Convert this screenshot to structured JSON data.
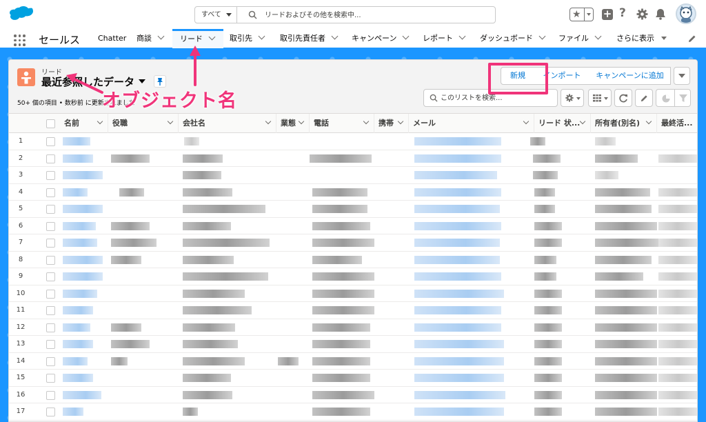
{
  "header": {
    "search_scope": "すべて",
    "search_placeholder": "リードおよびその他を検索中...",
    "icons": [
      "favorites-star-icon",
      "plus-icon",
      "help-icon",
      "gear-icon",
      "bell-icon",
      "avatar"
    ]
  },
  "nav": {
    "app_name": "セールス",
    "items": [
      {
        "label": "Chatter",
        "has_menu": false
      },
      {
        "label": "商談",
        "has_menu": true
      },
      {
        "label": "リード",
        "has_menu": true,
        "active": true
      },
      {
        "label": "取引先",
        "has_menu": true
      },
      {
        "label": "取引先責任者",
        "has_menu": true
      },
      {
        "label": "キャンペーン",
        "has_menu": true
      },
      {
        "label": "レポート",
        "has_menu": true
      },
      {
        "label": "ダッシュボード",
        "has_menu": true
      },
      {
        "label": "ファイル",
        "has_menu": true
      }
    ],
    "more_label": "さらに表示"
  },
  "list": {
    "object_label": "リード",
    "title": "最近参照したデータ",
    "info": "50+ 個の項目 • 数秒前 に更新されました",
    "buttons": {
      "new": "新規",
      "import": "インポート",
      "add_to_campaign": "キャンペーンに追加"
    },
    "search_placeholder": "このリストを検索...",
    "columns": [
      "名前",
      "役職",
      "会社名",
      "業態",
      "電話",
      "携帯",
      "メール",
      "リード 状...",
      "所有者(別名)",
      "最終活..."
    ],
    "row_numbers": [
      "1",
      "2",
      "3",
      "4",
      "5",
      "6",
      "7",
      "8",
      "9",
      "10",
      "11",
      "12",
      "13",
      "14",
      "15",
      "16",
      "17"
    ]
  },
  "annotation": {
    "label": "オブジェクト名",
    "color": "#f0347a"
  },
  "colors": {
    "brand": "#1b96ff",
    "link": "#0176d3",
    "object_icon": "#f88962"
  }
}
